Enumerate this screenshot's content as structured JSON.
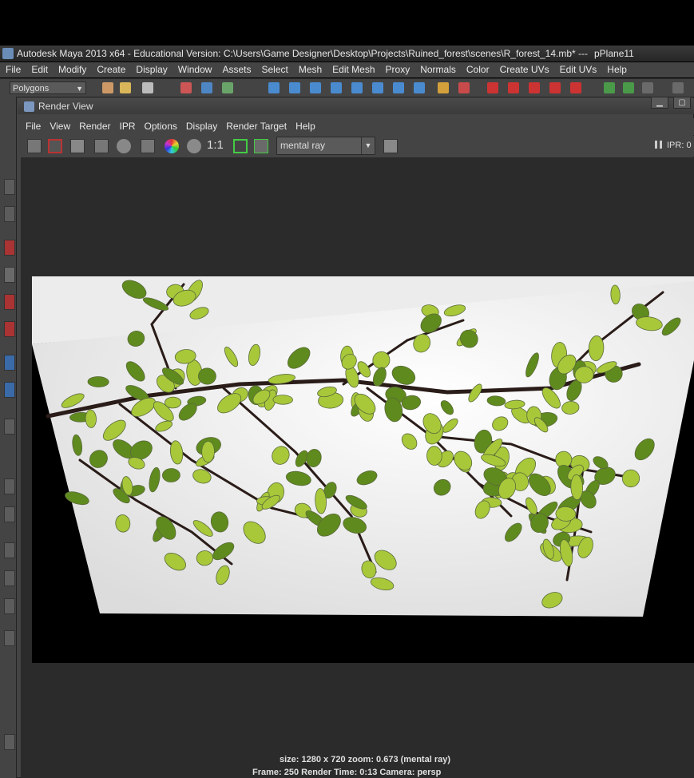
{
  "maya": {
    "title": "Autodesk Maya 2013 x64 - Educational Version: C:\\Users\\Game Designer\\Desktop\\Projects\\Ruined_forest\\scenes\\R_forest_14.mb*   ---   pPlane11",
    "title_file": "Autodesk Maya 2013 x64 - Educational Version: C:\\Users\\Game Designer\\Desktop\\Projects\\Ruined_forest\\scenes\\R_forest_14.mb*   ---",
    "title_object": "pPlane11",
    "menus": [
      "File",
      "Edit",
      "Modify",
      "Create",
      "Display",
      "Window",
      "Assets",
      "Select",
      "Mesh",
      "Edit Mesh",
      "Proxy",
      "Normals",
      "Color",
      "Create UVs",
      "Edit UVs",
      "Help"
    ],
    "mode": "Polygons"
  },
  "render_view": {
    "title": "Render View",
    "menus": [
      "File",
      "View",
      "Render",
      "IPR",
      "Options",
      "Display",
      "Render Target",
      "Help"
    ],
    "renderer": "mental ray",
    "ratio_label": "1:1",
    "ipr_label": "IPR: 0",
    "status_line1": "size: 1280 x 720 zoom: 0.673       (mental ray)",
    "status_line2": "Frame: 250       Render Time: 0:13       Camera: persp"
  },
  "colors": {
    "leaf": "#a8c83a",
    "leaf_dark": "#5f8a1e",
    "branch": "#2a1c18"
  },
  "icons": [
    "render-frame-icon",
    "redo-render-icon",
    "snapshot-icon",
    "ipr-render-icon",
    "refresh-icon",
    "region-render-icon",
    "rgb-channels-icon",
    "alpha-channel-icon",
    "fit-frame-icon",
    "keep-image-icon",
    "remove-image-icon"
  ]
}
